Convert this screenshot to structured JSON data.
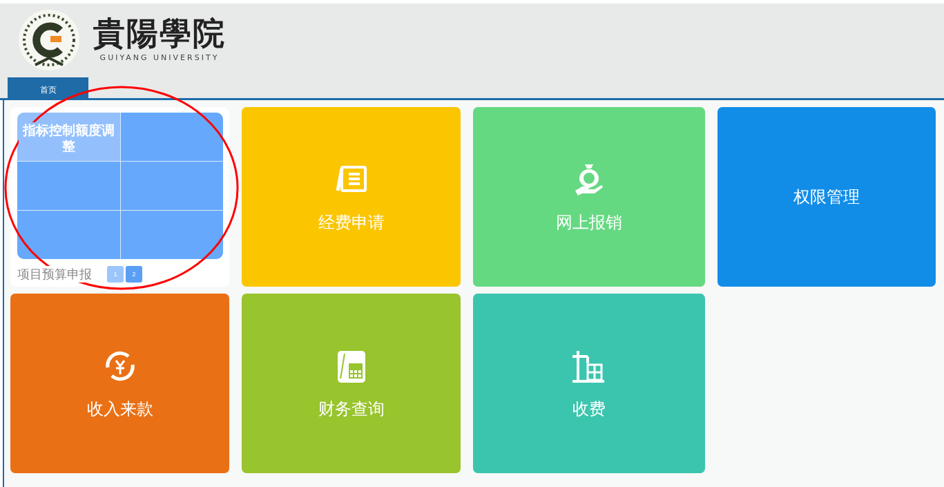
{
  "header": {
    "logo_title": "貴陽學院",
    "logo_subtitle": "GUIYANG UNIVERSITY"
  },
  "nav_tabs": [
    {
      "label": "首页",
      "selected": true
    }
  ],
  "tiles": [
    {
      "kind": "carousel",
      "slide_title": "指标控制额度调整",
      "caption": "项目预算申报",
      "pages": [
        {
          "label": "1",
          "selected": false
        },
        {
          "label": "2",
          "selected": true
        }
      ]
    },
    {
      "kind": "tile",
      "label": "经费申请",
      "color": "#fbc500"
    },
    {
      "kind": "tile",
      "label": "网上报销",
      "color": "#65d982"
    },
    {
      "kind": "tile",
      "label": "权限管理",
      "color": "#118de8"
    },
    {
      "kind": "tile",
      "label": "收入来款",
      "color": "#ea7015"
    },
    {
      "kind": "tile",
      "label": "财务查询",
      "color": "#98c42d"
    },
    {
      "kind": "tile",
      "label": "收费",
      "color": "#3cc5ae"
    }
  ],
  "annotation": {
    "kind": "ellipse",
    "color": "#ff0000"
  }
}
